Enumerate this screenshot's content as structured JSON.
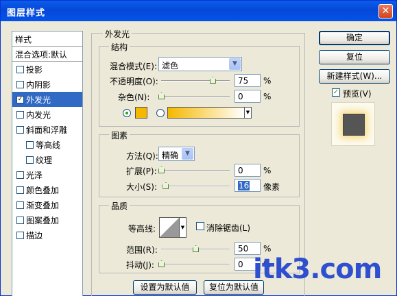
{
  "window": {
    "title": "图层样式"
  },
  "stylelist": {
    "header": "样式",
    "blend_options": "混合选项:默认",
    "items": [
      {
        "label": "投影",
        "checked": false,
        "sub": false,
        "selected": false
      },
      {
        "label": "内阴影",
        "checked": false,
        "sub": false,
        "selected": false
      },
      {
        "label": "外发光",
        "checked": true,
        "sub": false,
        "selected": true
      },
      {
        "label": "内发光",
        "checked": false,
        "sub": false,
        "selected": false
      },
      {
        "label": "斜面和浮雕",
        "checked": false,
        "sub": false,
        "selected": false
      },
      {
        "label": "等高线",
        "checked": false,
        "sub": true,
        "selected": false
      },
      {
        "label": "纹理",
        "checked": false,
        "sub": true,
        "selected": false
      },
      {
        "label": "光泽",
        "checked": false,
        "sub": false,
        "selected": false
      },
      {
        "label": "颜色叠加",
        "checked": false,
        "sub": false,
        "selected": false
      },
      {
        "label": "渐变叠加",
        "checked": false,
        "sub": false,
        "selected": false
      },
      {
        "label": "图案叠加",
        "checked": false,
        "sub": false,
        "selected": false
      },
      {
        "label": "描边",
        "checked": false,
        "sub": false,
        "selected": false
      }
    ]
  },
  "panel": {
    "title": "外发光"
  },
  "structure": {
    "title": "结构",
    "blend_mode_label": "混合模式(E):",
    "blend_mode_value": "滤色",
    "opacity_label": "不透明度(O):",
    "opacity_value": "75",
    "opacity_unit": "%",
    "opacity_fraction": 0.75,
    "noise_label": "杂色(N):",
    "noise_value": "0",
    "noise_unit": "%",
    "noise_fraction": 0,
    "glow_color": "#f5b800",
    "gradient_from": "#f5b800",
    "gradient_to": "#ffffff"
  },
  "elements": {
    "title": "图素",
    "technique_label": "方法(Q):",
    "technique_value": "精确",
    "spread_label": "扩展(P):",
    "spread_value": "0",
    "spread_unit": "%",
    "spread_fraction": 0,
    "size_label": "大小(S):",
    "size_value": "16",
    "size_unit": "像素",
    "size_fraction": 0.064
  },
  "quality": {
    "title": "品质",
    "contour_label": "等高线:",
    "antialias_label": "消除锯齿(L)",
    "antialias_checked": false,
    "range_label": "范围(R):",
    "range_value": "50",
    "range_unit": "%",
    "range_fraction": 0.5,
    "jitter_label": "抖动(J):",
    "jitter_value": "0",
    "jitter_unit": "%",
    "jitter_fraction": 0
  },
  "buttons": {
    "ok": "确定",
    "reset": "复位",
    "new_style": "新建样式(W)...",
    "preview": "预览(V)",
    "preview_checked": true,
    "make_default": "设置为默认值",
    "reset_default": "复位为默认值"
  },
  "watermark": "itk3.com"
}
